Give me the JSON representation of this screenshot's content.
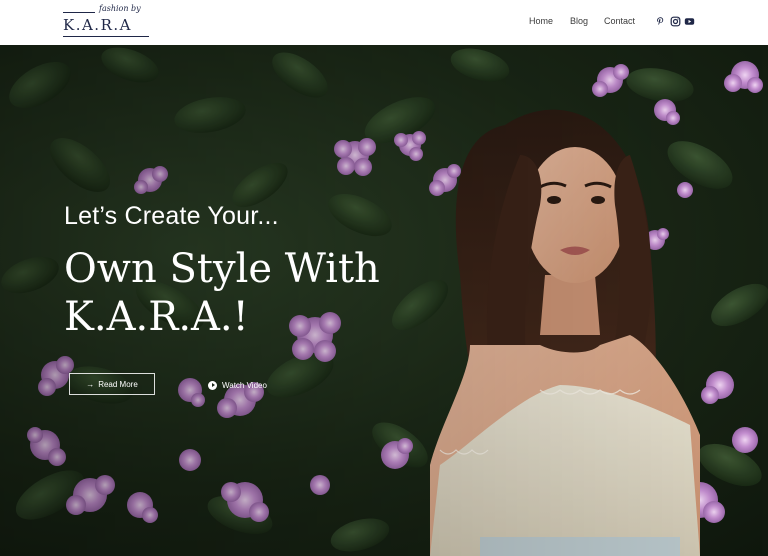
{
  "brand": {
    "tagline": "fashion by",
    "name": "K.A.R.A"
  },
  "nav": {
    "items": [
      {
        "label": "Home"
      },
      {
        "label": "Blog"
      },
      {
        "label": "Contact"
      }
    ]
  },
  "social": {
    "icons": [
      "pinterest-icon",
      "instagram-icon",
      "youtube-icon"
    ]
  },
  "hero": {
    "headline_small": "Let’s Create Your...",
    "headline_big": "Own Style With K.A.R.A.!",
    "read_more_label": "Read More",
    "watch_video_label": "Watch Video"
  },
  "colors": {
    "brand_navy": "#1f2747",
    "foliage_dark": "#1b2618",
    "flower_purple": "#b77fc4",
    "text_white": "#ffffff"
  }
}
